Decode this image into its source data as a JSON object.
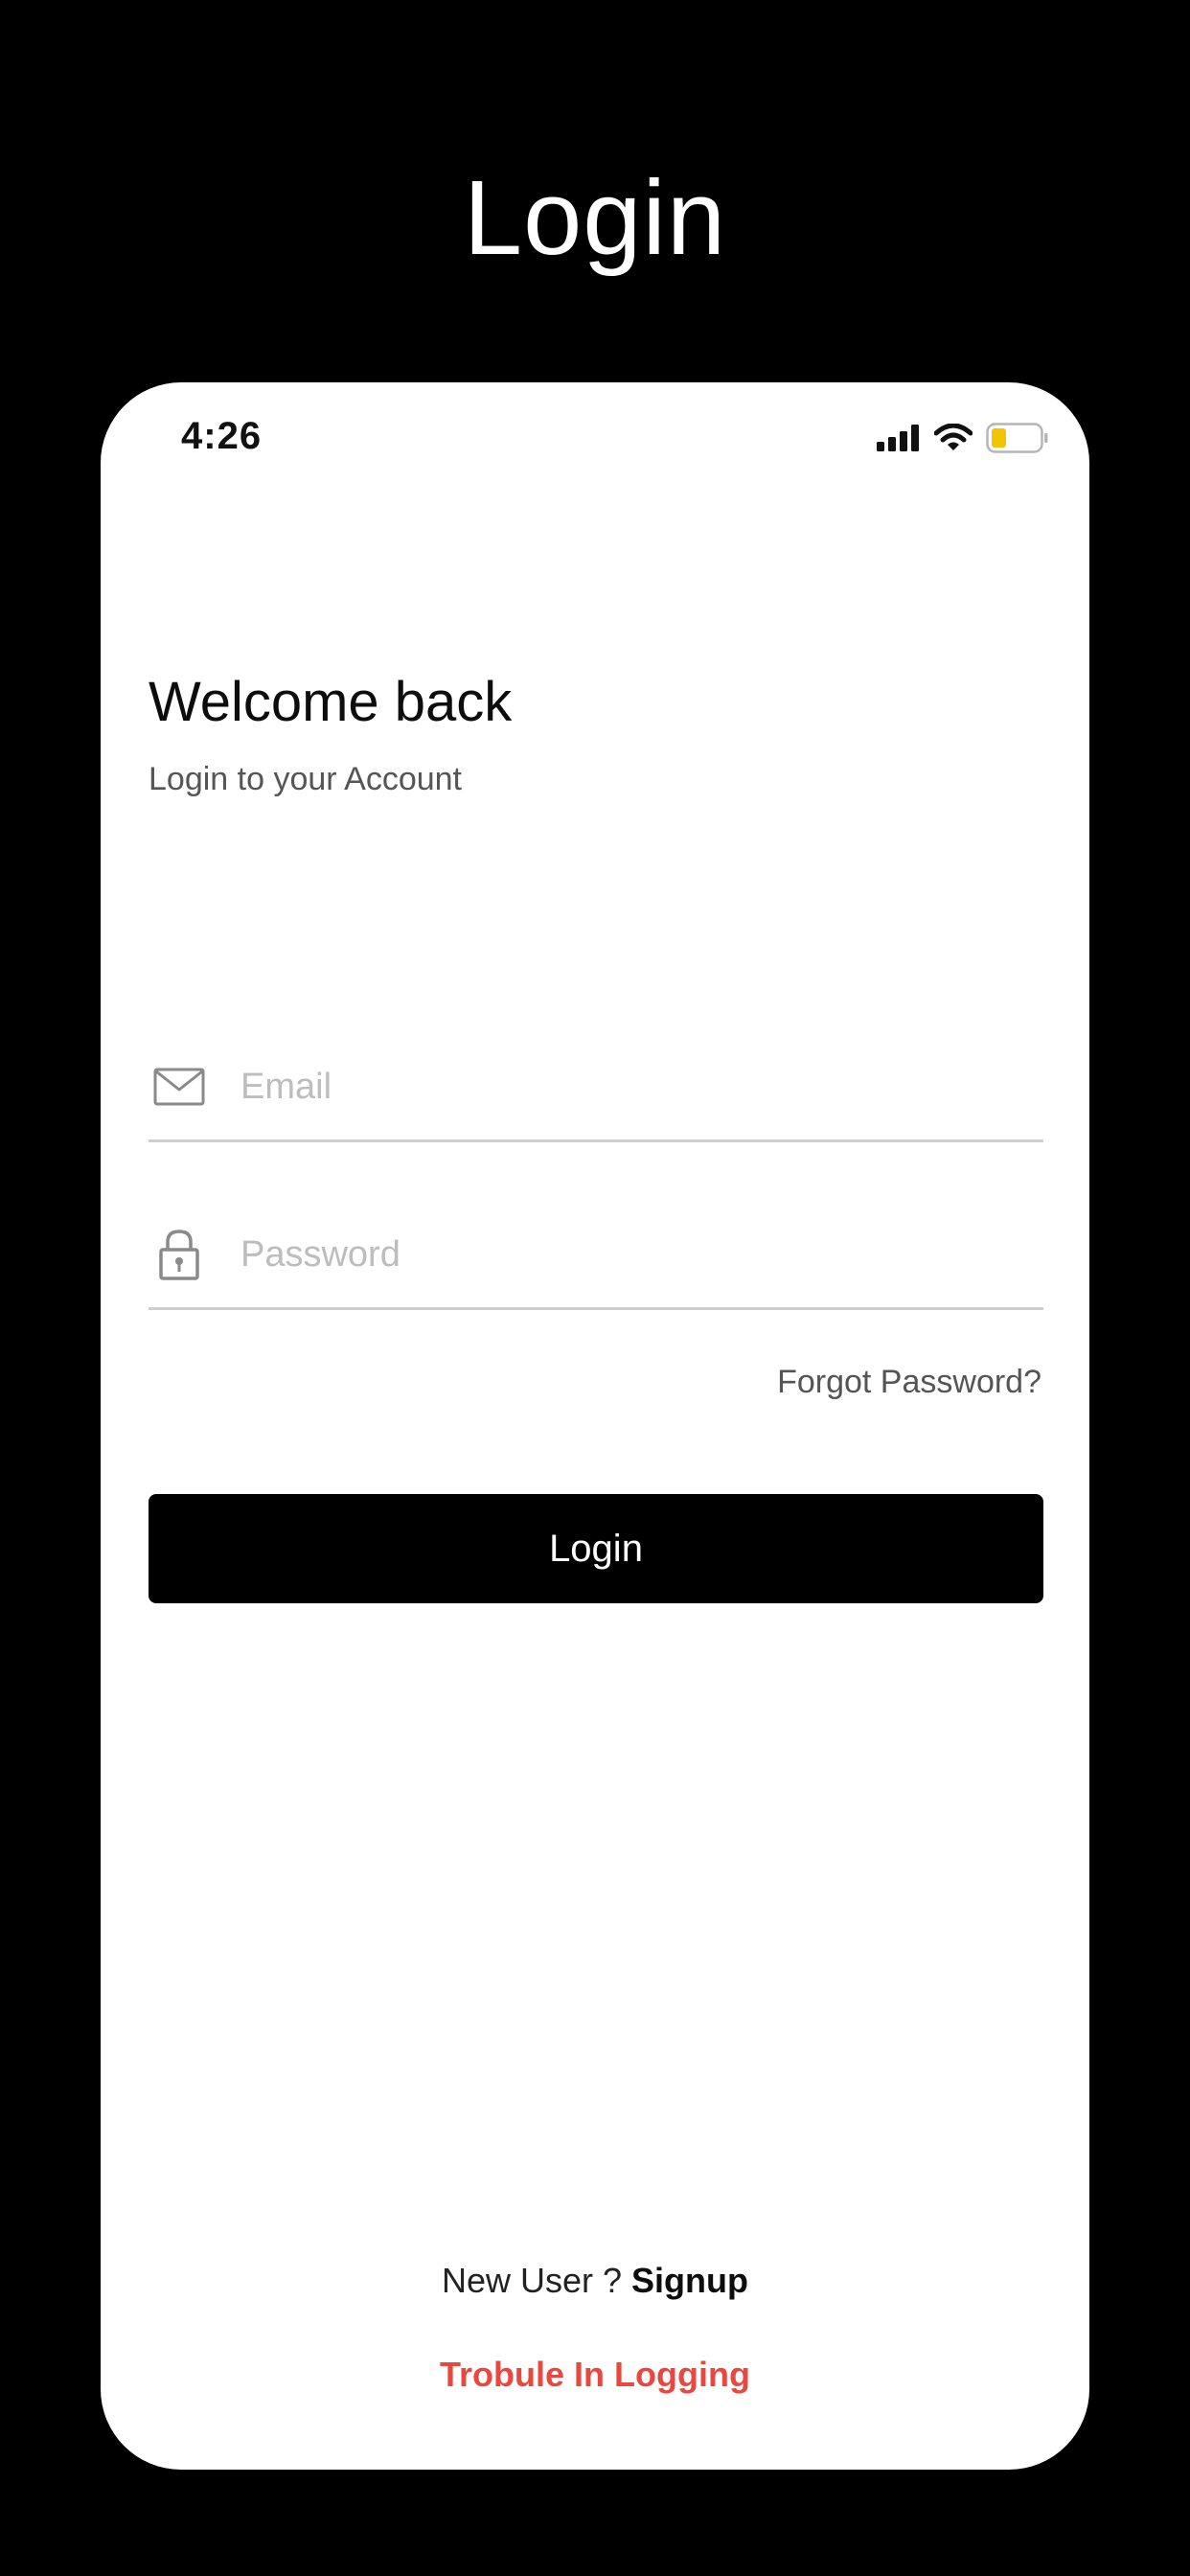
{
  "header": {
    "title": "Login"
  },
  "status_bar": {
    "time": "4:26",
    "icons": [
      "signal-icon",
      "wifi-icon",
      "battery-icon"
    ],
    "battery_color": "#f5c400"
  },
  "login_screen": {
    "welcome": "Welcome back",
    "subtitle": "Login to your Account",
    "email": {
      "placeholder": "Email",
      "value": "",
      "icon": "mail-icon"
    },
    "password": {
      "placeholder": "Password",
      "value": "",
      "icon": "lock-icon"
    },
    "forgot_label": "Forgot Password?",
    "login_label": "Login",
    "new_user_label": "New User ?",
    "signup_label": "Signup",
    "trouble_label": "Trobule In Logging"
  },
  "colors": {
    "background": "#000000",
    "card": "#ffffff",
    "button": "#000000",
    "accent_red": "#e8483f"
  }
}
